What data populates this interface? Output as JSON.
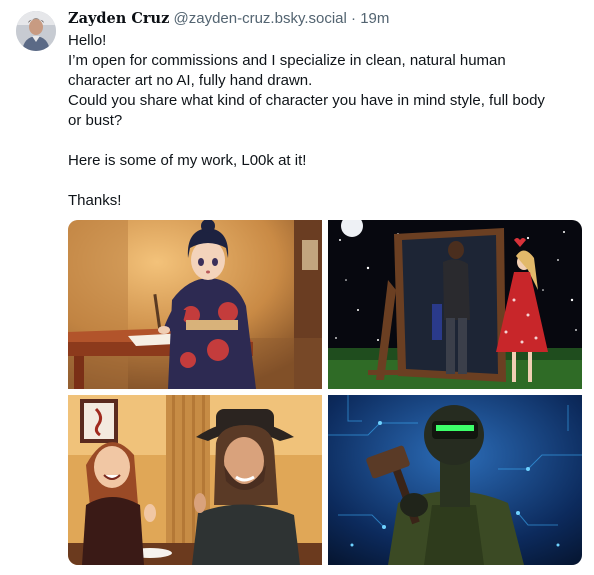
{
  "post": {
    "author_name": "Zayden Cruz",
    "author_handle": "@zayden-cruz.bsky.social",
    "separator": "·",
    "timestamp": "19m",
    "lines": [
      "Hello!",
      "I’m open for commissions and I specialize in clean, natural human",
      "character art no AI, fully hand drawn.",
      "Could you share what kind of character you have in mind style, full body",
      "or bust?",
      "",
      "Here is some of my work, L00k at it!",
      "",
      "Thanks!"
    ]
  },
  "images": [
    {
      "subject": "kimono-calligraphy-artwork"
    },
    {
      "subject": "mirror-couple-artwork"
    },
    {
      "subject": "cowboy-dinner-artwork"
    },
    {
      "subject": "armored-soldier-artwork"
    }
  ],
  "colors": {
    "text": "#0f1419",
    "muted": "#536471",
    "background": "#ffffff"
  }
}
